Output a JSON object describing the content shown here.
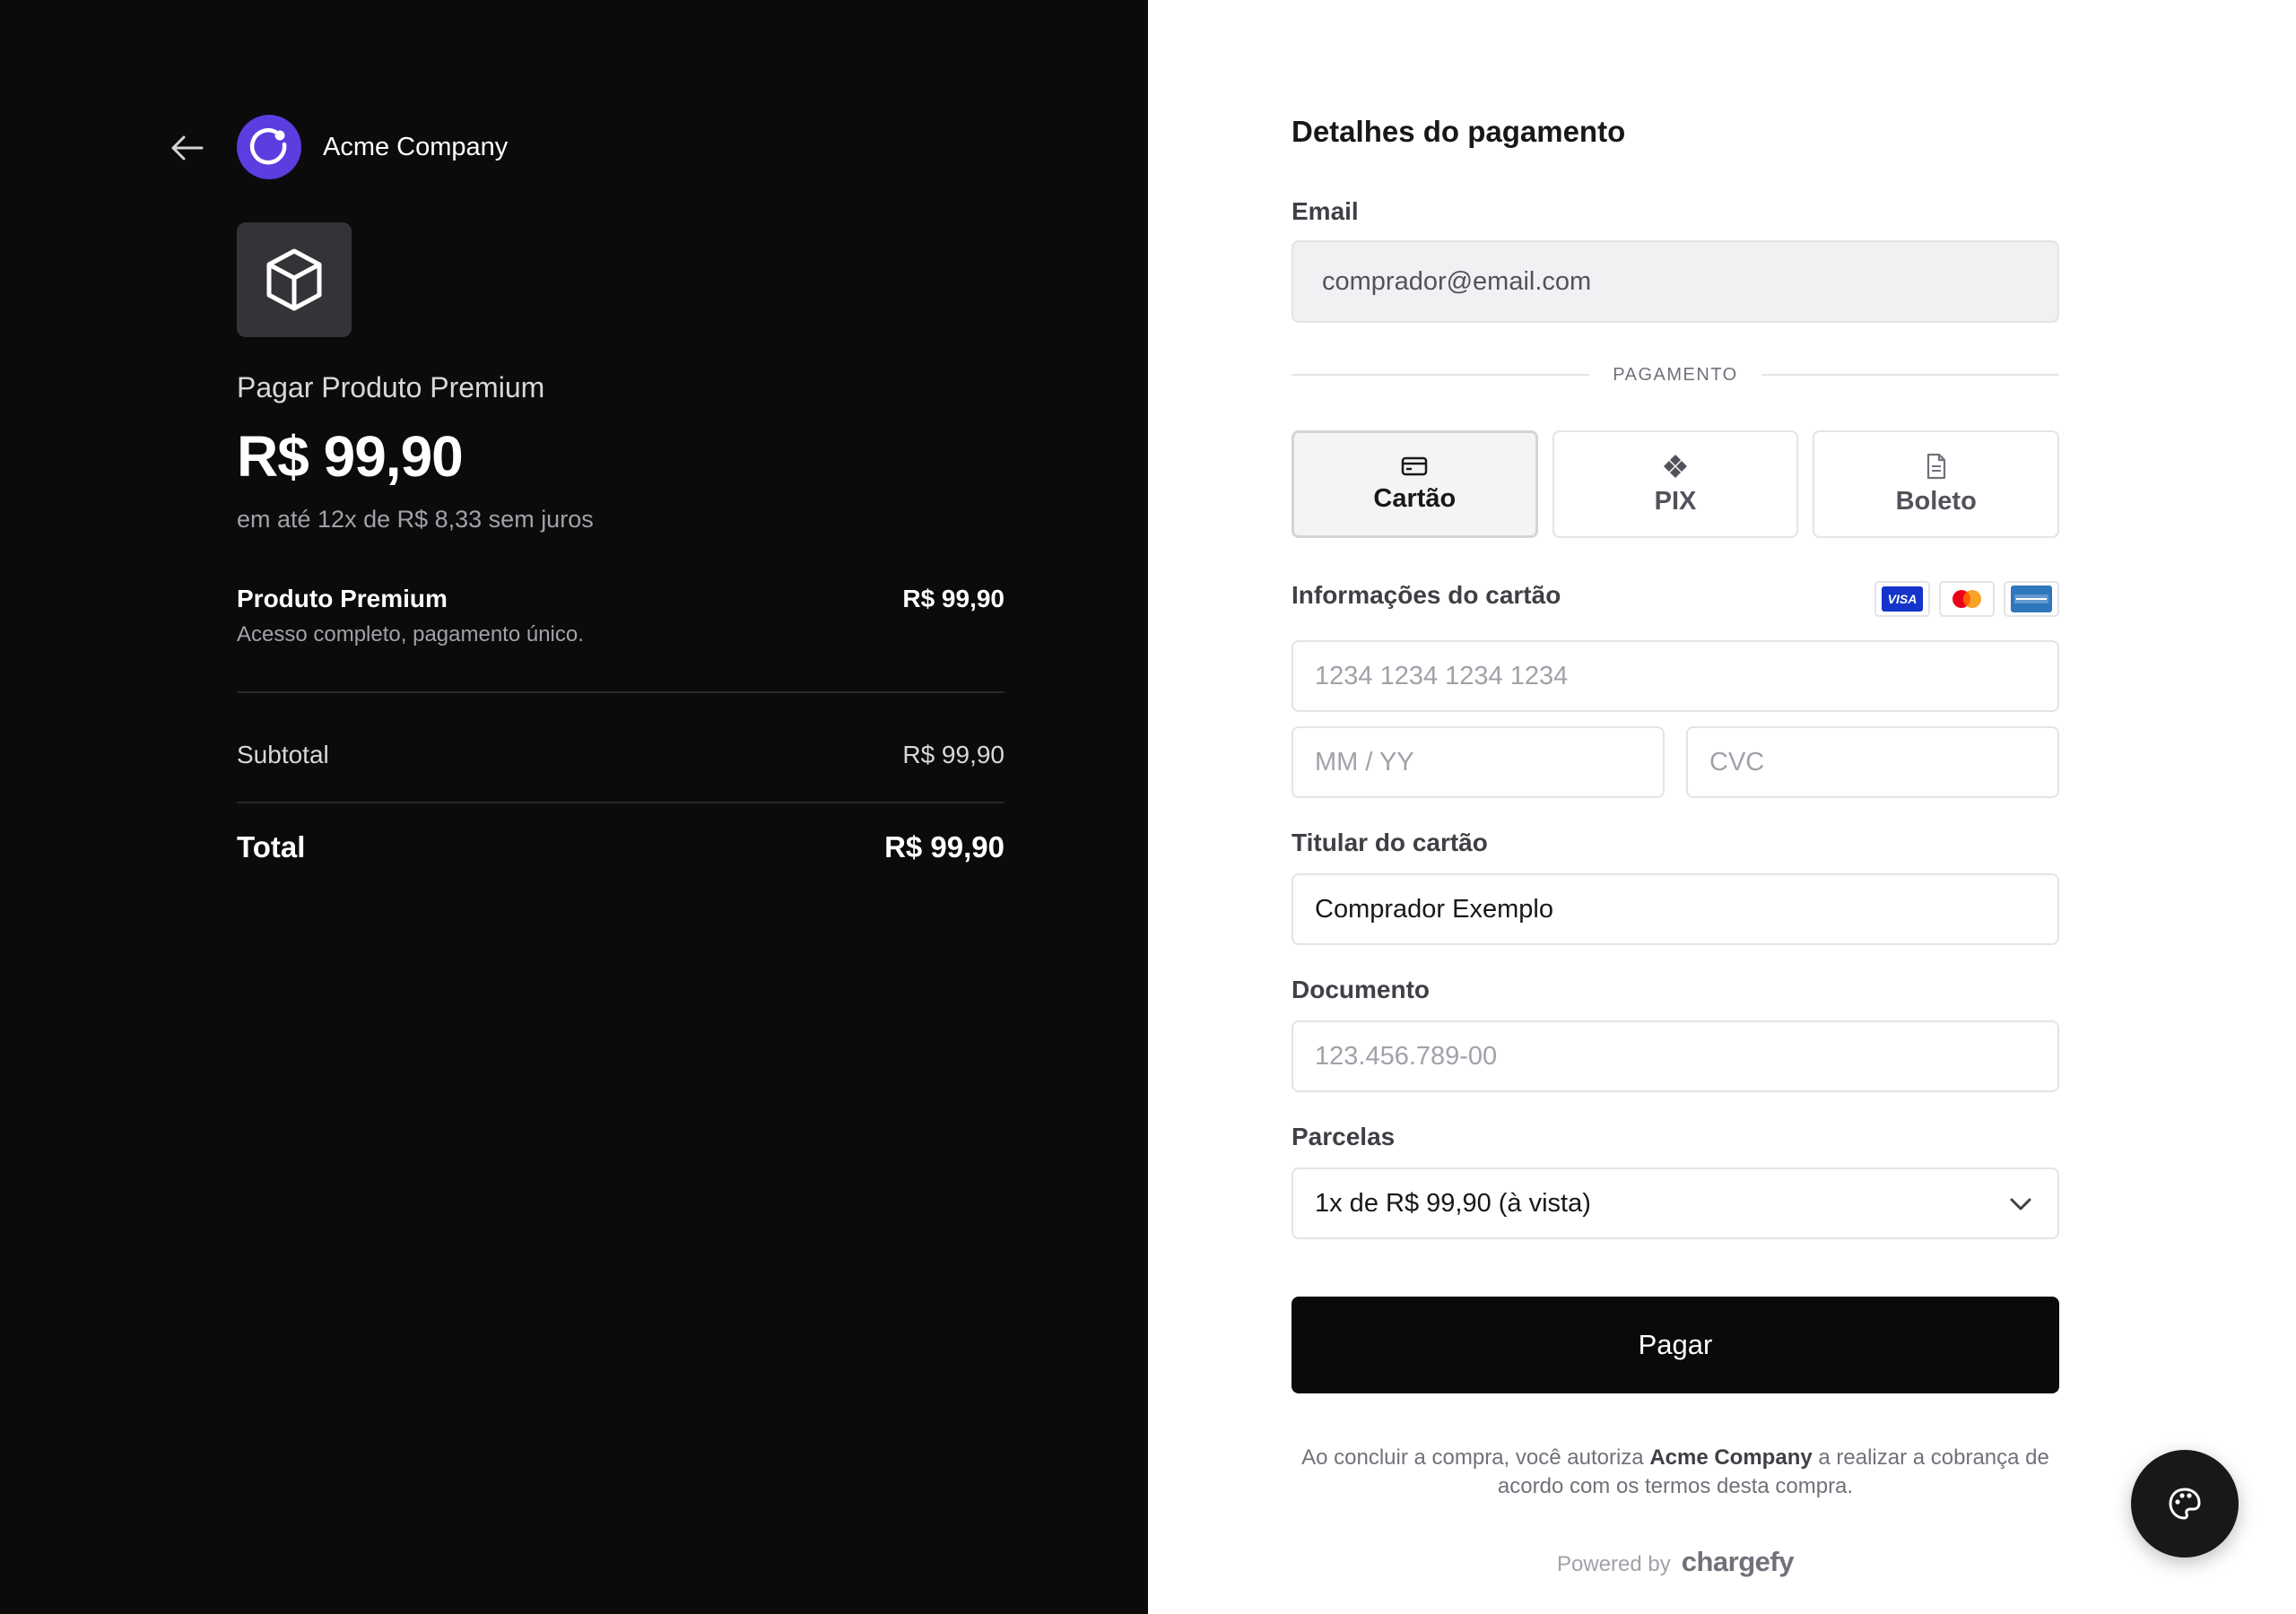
{
  "company": {
    "name": "Acme Company"
  },
  "summary": {
    "title": "Pagar Produto Premium",
    "price": "R$ 99,90",
    "installments_note": "em até 12x de R$ 8,33 sem juros",
    "items": [
      {
        "name": "Produto Premium",
        "description": "Acesso completo, pagamento único.",
        "price": "R$ 99,90"
      }
    ],
    "subtotal_label": "Subtotal",
    "subtotal_value": "R$ 99,90",
    "total_label": "Total",
    "total_value": "R$ 99,90"
  },
  "form": {
    "title": "Detalhes do pagamento",
    "email_label": "Email",
    "email_value": "comprador@email.com",
    "payment_section_label": "PAGAMENTO",
    "methods": [
      {
        "label": "Cartão",
        "icon": "credit-card-icon",
        "selected": true
      },
      {
        "label": "PIX",
        "icon": "pix-icon",
        "selected": false
      },
      {
        "label": "Boleto",
        "icon": "document-icon",
        "selected": false
      }
    ],
    "card_info_label": "Informações do cartão",
    "card_brands": [
      "VISA",
      "mastercard-icon",
      "amex-icon"
    ],
    "card_number_placeholder": "1234 1234 1234 1234",
    "expiry_placeholder": "MM / YY",
    "cvc_placeholder": "CVC",
    "holder_label": "Titular do cartão",
    "holder_value": "Comprador Exemplo",
    "document_label": "Documento",
    "document_placeholder": "123.456.789-00",
    "installments_label": "Parcelas",
    "installments_selected": "1x de R$ 99,90 (à vista)",
    "submit_label": "Pagar",
    "legal_prefix": "Ao concluir a compra, você autoriza",
    "legal_company": "Acme Company",
    "legal_suffix": "a realizar a cobrança de acordo com os termos desta compra.",
    "powered_by": "Powered by",
    "powered_brand": "chargefy"
  },
  "colors": {
    "left_bg": "#0b0b0c",
    "accent_logo": "#5b3de0",
    "button_bg": "#0a0a0a"
  }
}
